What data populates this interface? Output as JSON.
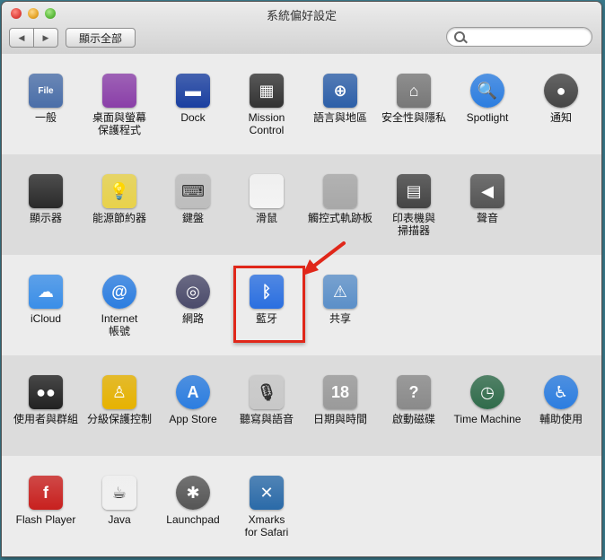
{
  "window": {
    "title": "系統偏好設定"
  },
  "toolbar": {
    "back": "◀",
    "forward": "▶",
    "show_all": "顯示全部",
    "search_placeholder": "",
    "search_value": ""
  },
  "sections": [
    {
      "items": [
        {
          "label": [
            "一般"
          ],
          "icon": "general-icon"
        },
        {
          "label": [
            "桌面與螢幕",
            "保護程式"
          ],
          "icon": "desktop-icon"
        },
        {
          "label": [
            "Dock"
          ],
          "icon": "dock-icon"
        },
        {
          "label": [
            "Mission",
            "Control"
          ],
          "icon": "mission-control-icon"
        },
        {
          "label": [
            "語言與地區"
          ],
          "icon": "language-icon"
        },
        {
          "label": [
            "安全性與隱私"
          ],
          "icon": "security-icon"
        },
        {
          "label": [
            "Spotlight"
          ],
          "icon": "spotlight-icon"
        },
        {
          "label": [
            "通知"
          ],
          "icon": "notifications-icon"
        }
      ]
    },
    {
      "items": [
        {
          "label": [
            "顯示器"
          ],
          "icon": "display-icon"
        },
        {
          "label": [
            "能源節約器"
          ],
          "icon": "energy-icon"
        },
        {
          "label": [
            "鍵盤"
          ],
          "icon": "keyboard-icon"
        },
        {
          "label": [
            "滑鼠"
          ],
          "icon": "mouse-icon"
        },
        {
          "label": [
            "觸控式軌跡板"
          ],
          "icon": "trackpad-icon"
        },
        {
          "label": [
            "印表機與",
            "掃描器"
          ],
          "icon": "printer-icon"
        },
        {
          "label": [
            "聲音"
          ],
          "icon": "sound-icon"
        }
      ]
    },
    {
      "items": [
        {
          "label": [
            "iCloud"
          ],
          "icon": "icloud-icon"
        },
        {
          "label": [
            "Internet",
            "帳號"
          ],
          "icon": "internet-accounts-icon"
        },
        {
          "label": [
            "網路"
          ],
          "icon": "network-icon"
        },
        {
          "label": [
            "藍牙"
          ],
          "icon": "bluetooth-icon"
        },
        {
          "label": [
            "共享"
          ],
          "icon": "sharing-icon"
        }
      ]
    },
    {
      "items": [
        {
          "label": [
            "使用者與群組"
          ],
          "icon": "users-icon"
        },
        {
          "label": [
            "分級保護控制"
          ],
          "icon": "parental-controls-icon"
        },
        {
          "label": [
            "App Store"
          ],
          "icon": "app-store-icon"
        },
        {
          "label": [
            "聽寫與語音"
          ],
          "icon": "dictation-icon"
        },
        {
          "label": [
            "日期與時間"
          ],
          "icon": "date-time-icon"
        },
        {
          "label": [
            "啟動磁碟"
          ],
          "icon": "startup-disk-icon"
        },
        {
          "label": [
            "Time Machine"
          ],
          "icon": "time-machine-icon"
        },
        {
          "label": [
            "輔助使用"
          ],
          "icon": "accessibility-icon"
        }
      ]
    },
    {
      "items": [
        {
          "label": [
            "Flash Player"
          ],
          "icon": "flash-icon"
        },
        {
          "label": [
            "Java"
          ],
          "icon": "java-icon"
        },
        {
          "label": [
            "Launchpad"
          ],
          "icon": "launchpad-icon"
        },
        {
          "label": [
            "Xmarks",
            "for Safari"
          ],
          "icon": "xmarks-icon"
        }
      ]
    }
  ],
  "icon_glyphs": {
    "general-icon": "File",
    "dock-icon": "▬",
    "spotlight-icon": "🔍",
    "notifications-icon": "●",
    "bluetooth-icon": "ᛒ",
    "internet-accounts-icon": "@",
    "app-store-icon": "A",
    "java-icon": "☕",
    "flash-icon": "f",
    "accessibility-icon": "♿",
    "date-time-icon": "18",
    "time-machine-icon": "◷",
    "xmarks-icon": "✕",
    "sharing-icon": "⚠",
    "security-icon": "⌂",
    "language-icon": "⊕",
    "parental-controls-icon": "♙",
    "users-icon": "●●",
    "dictation-icon": "🎙",
    "startup-disk-icon": "?",
    "launchpad-icon": "✱",
    "network-icon": "◎",
    "sound-icon": "◀",
    "printer-icon": "▤",
    "mouse-icon": "",
    "keyboard-icon": "⌨",
    "trackpad-icon": "",
    "display-icon": "",
    "energy-icon": "💡",
    "desktop-icon": "",
    "mission-control-icon": "▦",
    "icloud-icon": "☁"
  },
  "icon_colors": {
    "general-icon": "#4a6ea8",
    "desktop-icon": "#8a3fa8",
    "dock-icon": "#1a3fa0",
    "mission-control-icon": "#333333",
    "language-icon": "#2d5fa8",
    "security-icon": "#777777",
    "spotlight-icon": "#2b7de0",
    "notifications-icon": "#444444",
    "display-icon": "#2a2a2a",
    "energy-icon": "#e8d24a",
    "keyboard-icon": "#bdbdbd",
    "mouse-icon": "#f4f4f4",
    "trackpad-icon": "#a8a8a8",
    "printer-icon": "#444444",
    "sound-icon": "#555555",
    "icloud-icon": "#3a8ee8",
    "internet-accounts-icon": "#2b7de0",
    "network-icon": "#4a4a6a",
    "bluetooth-icon": "#2a6fe0",
    "sharing-icon": "#5b8fc8",
    "users-icon": "#222222",
    "parental-controls-icon": "#e6b200",
    "app-store-icon": "#2b7de0",
    "dictation-icon": "#c8c8c8",
    "date-time-icon": "#9a9a9a",
    "startup-disk-icon": "#8a8a8a",
    "time-machine-icon": "#2f6b4a",
    "accessibility-icon": "#2b7de0",
    "flash-icon": "#c8201e",
    "java-icon": "#f0f0f0",
    "launchpad-icon": "#555555",
    "xmarks-icon": "#2a6aa8"
  }
}
